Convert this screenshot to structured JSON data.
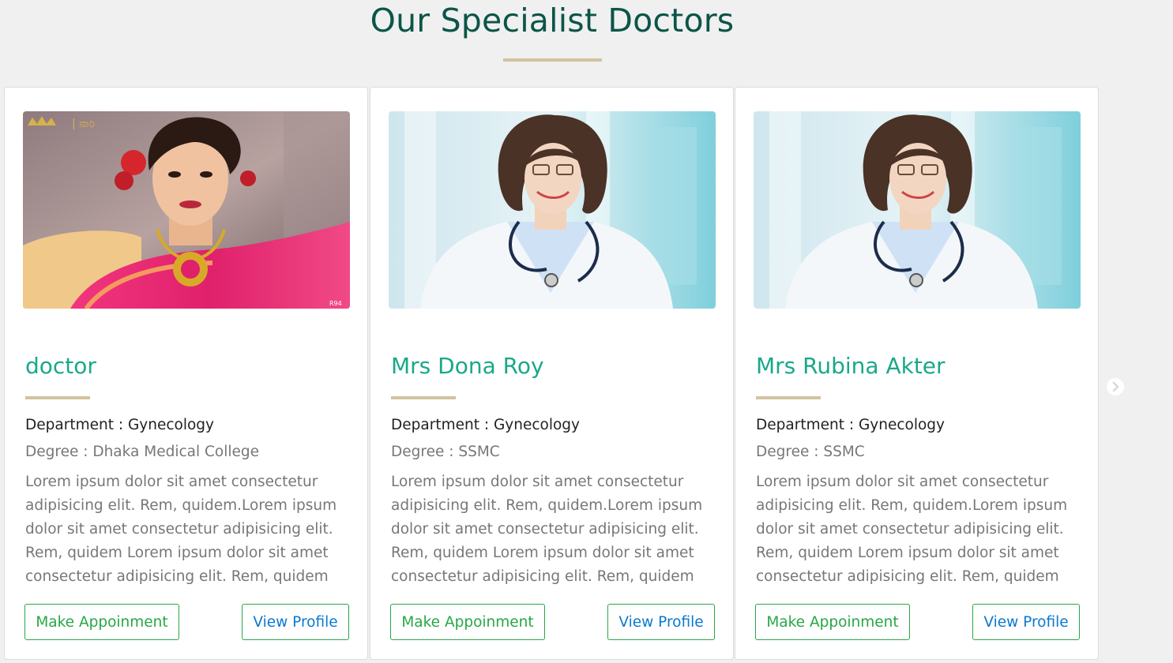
{
  "section": {
    "title": "Our Specialist Doctors"
  },
  "doctors": [
    {
      "name": "doctor",
      "department": "Department : Gynecology",
      "degree": "Degree : Dhaka Medical College",
      "description": "Lorem ipsum dolor sit amet consectetur adipisicing elit. Rem, quidem.Lorem ipsum dolor sit amet consectetur adipisicing elit. Rem, quidem Lorem ipsum dolor sit amet consectetur adipisicing elit. Rem, quidem",
      "appoint_label": "Make Appoinment",
      "profile_label": "View Profile",
      "photo": "woman-in-pink-saree-photo"
    },
    {
      "name": "Mrs Dona Roy",
      "department": "Department : Gynecology",
      "degree": "Degree : SSMC",
      "description": "Lorem ipsum dolor sit amet consectetur adipisicing elit. Rem, quidem.Lorem ipsum dolor sit amet consectetur adipisicing elit. Rem, quidem Lorem ipsum dolor sit amet consectetur adipisicing elit. Rem, quidem",
      "appoint_label": "Make Appoinment",
      "profile_label": "View Profile",
      "photo": "female-doctor-with-stethoscope-photo"
    },
    {
      "name": "Mrs Rubina Akter",
      "department": "Department : Gynecology",
      "degree": "Degree : SSMC",
      "description": "Lorem ipsum dolor sit amet consectetur adipisicing elit. Rem, quidem.Lorem ipsum dolor sit amet consectetur adipisicing elit. Rem, quidem Lorem ipsum dolor sit amet consectetur adipisicing elit. Rem, quidem",
      "appoint_label": "Make Appoinment",
      "profile_label": "View Profile",
      "photo": "female-doctor-with-stethoscope-photo"
    }
  ],
  "carousel": {
    "next_icon": "chevron-right-icon"
  },
  "colors": {
    "title": "#0b5548",
    "name": "#1aa88a",
    "accent_rule": "#d2c3a0",
    "button_border": "#28a745",
    "appoint_text": "#28a745",
    "profile_text": "#0a78d0"
  }
}
